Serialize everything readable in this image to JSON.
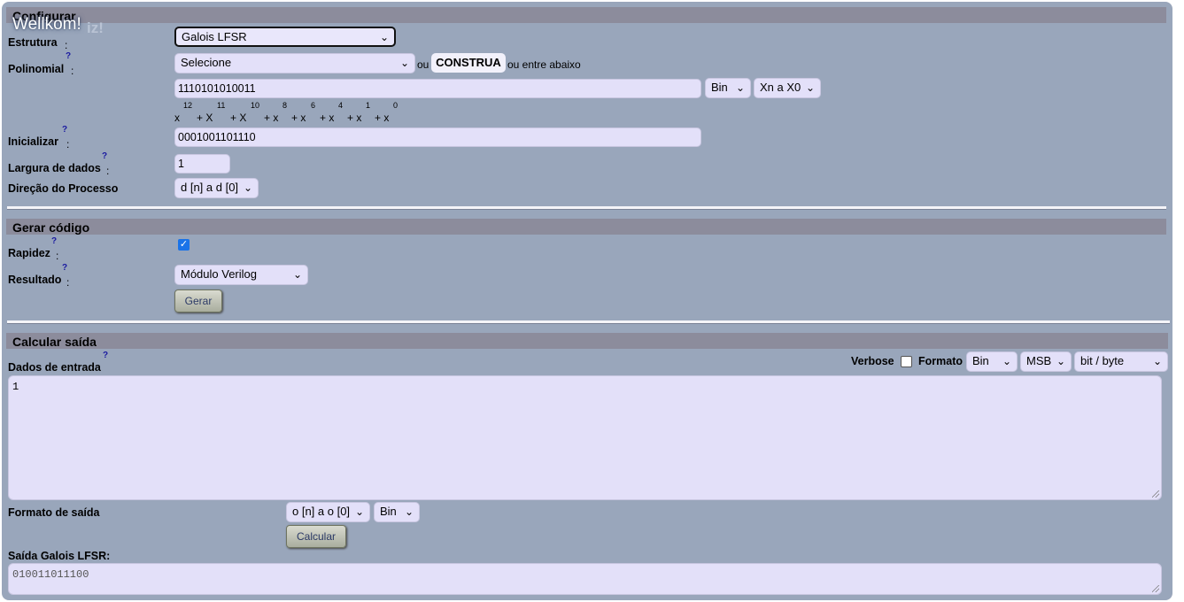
{
  "banner": {
    "welcome": "Wellkom!",
    "ghost": "iz!"
  },
  "config": {
    "title": "Configurar",
    "structure_label": "Estrutura",
    "structure_value": "Galois LFSR",
    "poly_label": "Polinomial",
    "poly_select": "Selecione",
    "or1": "ou",
    "build_button": "CONSTRUA",
    "or2": "ou entre abaixo",
    "poly_value": "1110101010011",
    "poly_base": "Bin",
    "poly_order": "Xn a X0",
    "poly_terms": [
      {
        "base": "x",
        "exp": "12"
      },
      {
        "base": "+ X",
        "exp": "11"
      },
      {
        "base": "+ X",
        "exp": "10"
      },
      {
        "base": "+ x",
        "exp": "8"
      },
      {
        "base": "+ x",
        "exp": "6"
      },
      {
        "base": "+ x",
        "exp": "4"
      },
      {
        "base": "+ x",
        "exp": "1"
      },
      {
        "base": "+ x",
        "exp": "0"
      }
    ],
    "init_label": "Inicializar",
    "init_value": "0001001101110",
    "width_label": "Largura de dados",
    "width_value": "1",
    "direction_label": "Direção do Processo",
    "direction_value": "d [n] a d [0]"
  },
  "gen": {
    "title": "Gerar código",
    "speed_label": "Rapidez",
    "speed_checked": true,
    "result_label": "Resultado",
    "result_value": "Módulo Verilog",
    "gen_button": "Gerar"
  },
  "calc": {
    "title": "Calcular saída",
    "input_label": "Dados de entrada",
    "verbose_label": "Verbose",
    "format_label": "Formato",
    "fmt_base": "Bin",
    "fmt_order": "MSB",
    "fmt_unit": "bit / byte",
    "input_value": "1",
    "out_format_label": "Formato de saída",
    "out_dir": "o [n] a o [0]",
    "out_base": "Bin",
    "calc_button": "Calcular",
    "output_label": "Saída Galois LFSR:",
    "output_value": "010011011100"
  },
  "ui": {
    "help_mark": "?",
    "colon": ":",
    "chevron": "⌄",
    "check": "✓"
  }
}
